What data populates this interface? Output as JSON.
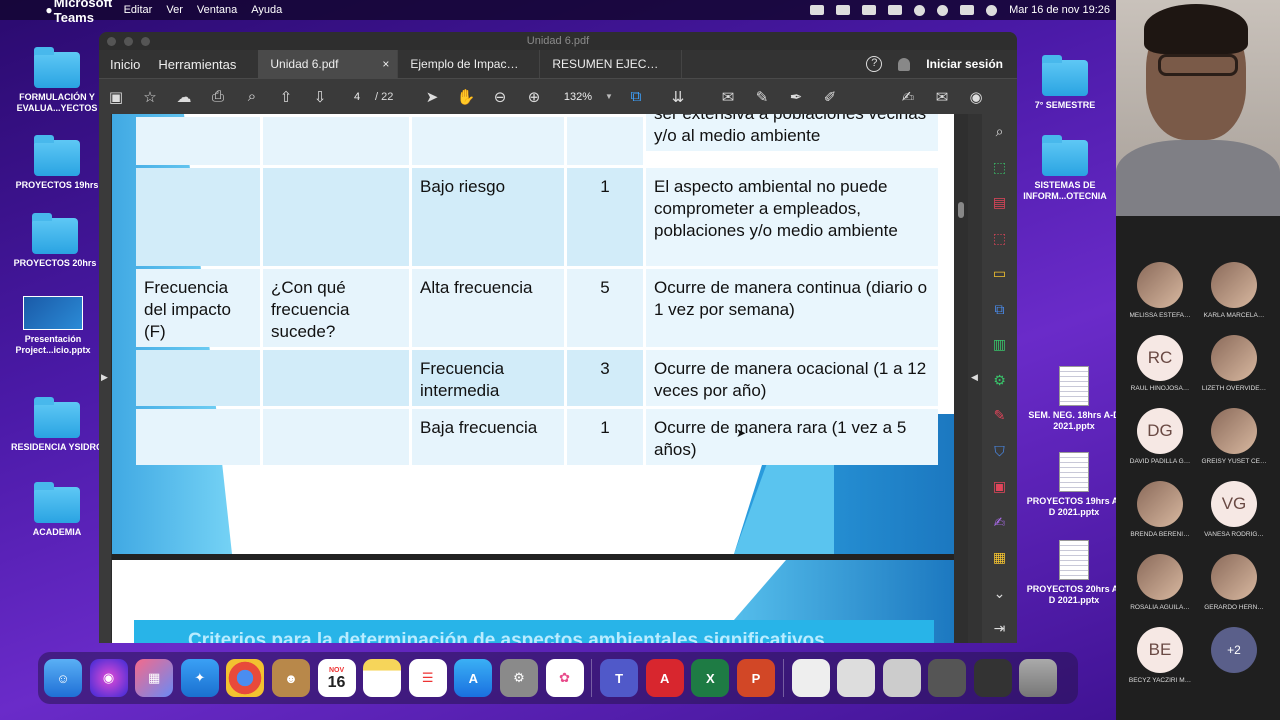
{
  "menubar": {
    "app": "Microsoft Teams",
    "items": [
      "Editar",
      "Ver",
      "Ventana",
      "Ayuda"
    ],
    "datetime": "Mar 16 de nov  19:26"
  },
  "desktop_left": [
    {
      "label": "FORMULACIÓN Y EVALUA...YECTOS"
    },
    {
      "label": "PROYECTOS 19hrs"
    },
    {
      "label": "PROYECTOS 20hrs"
    },
    {
      "label": "Presentación Project...icio.pptx"
    },
    {
      "label": "RESIDENCIA YSIDRO"
    },
    {
      "label": "ACADEMIA"
    }
  ],
  "desktop_right": [
    {
      "label": "7° SEMESTRE"
    },
    {
      "label": "SISTEMAS DE INFORM...OTECNIA"
    },
    {
      "label": "SEM. NEG. 18hrs A-D 2021.pptx"
    },
    {
      "label": "PROYECTOS 19hrs A-D 2021.pptx"
    },
    {
      "label": "PROYECTOS 20hrs A-D 2021.pptx"
    }
  ],
  "pdf": {
    "window_title": "Unidad 6.pdf",
    "nav": {
      "home": "Inicio",
      "tools": "Herramientas"
    },
    "tabs": [
      {
        "label": "Unidad 6.pdf",
        "close": "×"
      },
      {
        "label": "Ejemplo de Impac…"
      },
      {
        "label": "RESUMEN EJEC…"
      }
    ],
    "help": "?",
    "signin": "Iniciar sesión",
    "page_current": "4",
    "page_total": "/ 22",
    "zoom": "132%",
    "page2_heading": "Criterios para la determinación de aspectos ambientales significativos"
  },
  "table": {
    "rows": [
      {
        "c1": "",
        "c2": "",
        "c3": "",
        "c4": "",
        "c5": "ser extensiva a poblaciones vecinas y/o al medio ambiente"
      },
      {
        "c1": "",
        "c2": "",
        "c3": "Bajo riesgo",
        "c4": "1",
        "c5": "El aspecto ambiental no puede comprometer a empleados, poblaciones y/o medio ambiente"
      },
      {
        "c1": "Frecuencia del impacto (F)",
        "c2": "¿Con qué frecuencia sucede?",
        "c3": "Alta frecuencia",
        "c4": "5",
        "c5": "Ocurre de manera continua (diario o 1 vez por semana)"
      },
      {
        "c1": "",
        "c2": "",
        "c3": "Frecuencia intermedia",
        "c4": "3",
        "c5": "Ocurre de manera ocacional (1 a 12 veces por año)"
      },
      {
        "c1": "",
        "c2": "",
        "c3": "Baja frecuencia",
        "c4": "1",
        "c5": "Ocurre de manera rara (1 vez a 5 años)"
      }
    ]
  },
  "participants": [
    {
      "name": "MELISSA ESTEFA…",
      "initials": ""
    },
    {
      "name": "KARLA MARCELA…",
      "initials": ""
    },
    {
      "name": "RAUL HINOJOSA…",
      "initials": "RC"
    },
    {
      "name": "LIZETH OVERVIDE…",
      "initials": ""
    },
    {
      "name": "DAVID PADILLA G…",
      "initials": "DG"
    },
    {
      "name": "GREISY YUSET CE…",
      "initials": ""
    },
    {
      "name": "BRENDA BERENI…",
      "initials": ""
    },
    {
      "name": "VANESA RODRIG…",
      "initials": "VG"
    },
    {
      "name": "ROSALIA AGUILA…",
      "initials": ""
    },
    {
      "name": "GERARDO HERN…",
      "initials": ""
    },
    {
      "name": "BECYZ YACZIRI M…",
      "initials": "BE"
    },
    {
      "name": "",
      "initials": "+2"
    }
  ],
  "dock": {
    "calendar_month": "NOV",
    "calendar_day": "16"
  },
  "colors": {
    "accent": "#3ea2ff",
    "table_cell": "#d2ecf9",
    "banner": "#28b4e8"
  }
}
